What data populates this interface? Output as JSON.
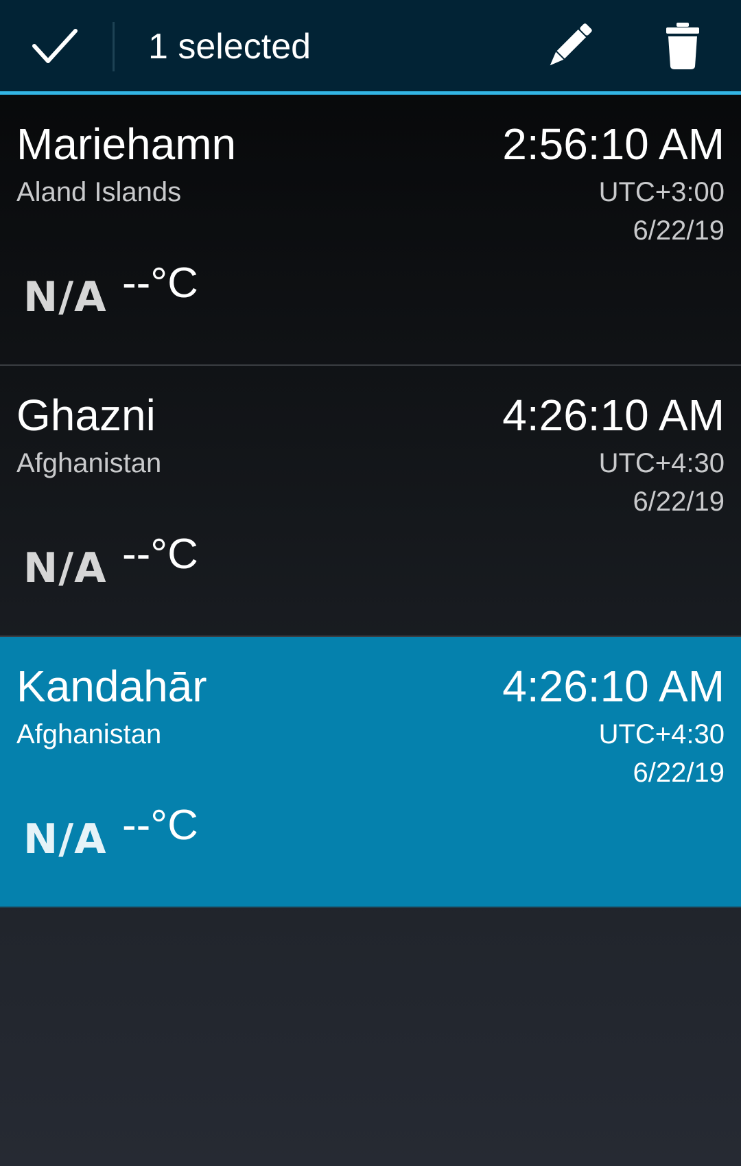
{
  "action_bar": {
    "selection_text": "1 selected",
    "done_icon": "checkmark-icon",
    "edit_icon": "pencil-icon",
    "delete_icon": "trash-icon",
    "background_color": "#022335",
    "accent_color": "#33b5e5"
  },
  "clocks": [
    {
      "city": "Mariehamn",
      "country": "Aland Islands",
      "time": "2:56:10 AM",
      "utc_offset": "UTC+3:00",
      "date": "6/22/19",
      "weather": "N/A",
      "temperature": "--°C",
      "selected": false
    },
    {
      "city": "Ghazni",
      "country": "Afghanistan",
      "time": "4:26:10 AM",
      "utc_offset": "UTC+4:30",
      "date": "6/22/19",
      "weather": "N/A",
      "temperature": "--°C",
      "selected": false
    },
    {
      "city": "Kandahār",
      "country": "Afghanistan",
      "time": "4:26:10 AM",
      "utc_offset": "UTC+4:30",
      "date": "6/22/19",
      "weather": "N/A",
      "temperature": "--°C",
      "selected": true
    }
  ],
  "selected_row_color": "#0581ad"
}
